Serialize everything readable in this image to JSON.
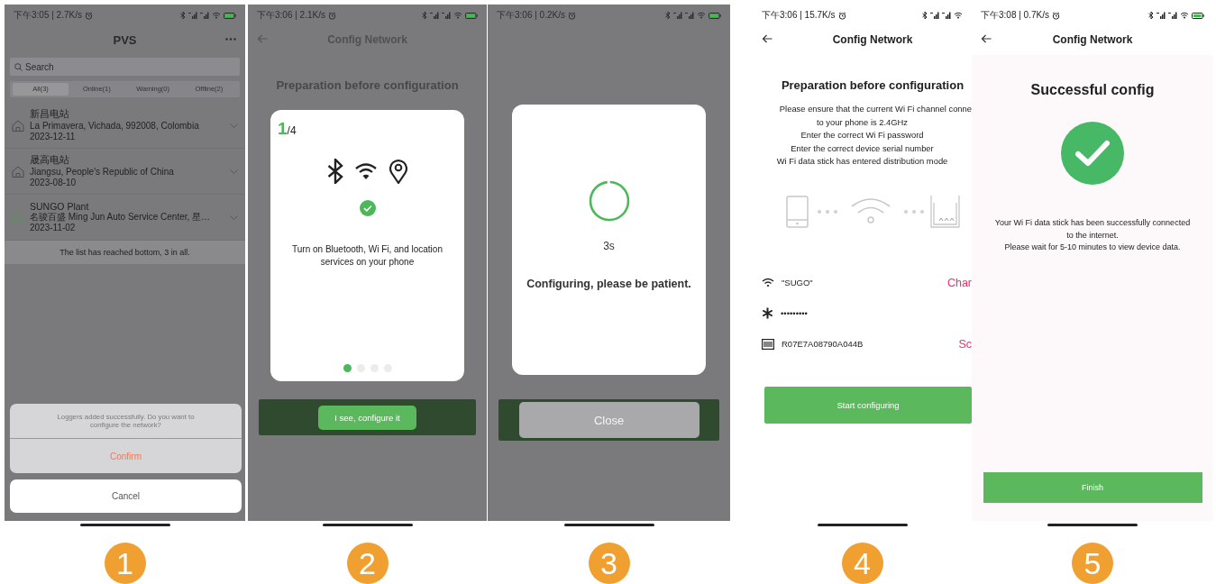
{
  "screens": [
    {
      "kind": "plant_list",
      "step": "1",
      "status_bar": {
        "time": "下午3:05 | 2.7K/s"
      },
      "title": "PVS",
      "search": {
        "placeholder": "Search"
      },
      "tabs": [
        {
          "label": "All(3)",
          "selected": true
        },
        {
          "label": "Online(1)",
          "selected": false
        },
        {
          "label": "Warning(0)",
          "selected": false
        },
        {
          "label": "Offline(2)",
          "selected": false
        }
      ],
      "plants": [
        {
          "name": "新昌电站",
          "address": "La Primavera, Vichada, 992008, Colombia",
          "date": "2023-12-11",
          "online": false
        },
        {
          "name": "晟高电站",
          "address": "Jiangsu, People's Republic of China",
          "date": "2023-08-10",
          "online": false
        },
        {
          "name": "SUNGO Plant",
          "address": "名骏百盛 Ming Jun Auto Service Center, 星…",
          "date": "2023-11-02",
          "online": true
        }
      ],
      "footer": "The list has reached bottom, 3 in all.",
      "action_sheet": {
        "message": "Loggers added successfully. Do you want to configure the network?",
        "confirm": "Confirm",
        "cancel": "Cancel"
      }
    },
    {
      "kind": "guide_dialog",
      "step": "2",
      "status_bar": {
        "time": "下午3:06 | 2.1K/s"
      },
      "title": "Config Network",
      "heading": "Preparation before configuration",
      "dialog": {
        "page": "1",
        "total": "/4",
        "text": "Turn on Bluetooth, Wi Fi, and location services on your phone",
        "pages": [
          {
            "selected": true
          },
          {
            "selected": false
          },
          {
            "selected": false
          },
          {
            "selected": false
          }
        ],
        "button": "I see, configure it"
      }
    },
    {
      "kind": "progress_dialog",
      "step": "3",
      "status_bar": {
        "time": "下午3:06 | 0.2K/s"
      },
      "dialog": {
        "countdown": "3s",
        "message": "Configuring, please be patient.",
        "button": "Close"
      }
    },
    {
      "kind": "config_form",
      "step": "4",
      "status_bar": {
        "time": "下午3:06 | 15.7K/s"
      },
      "title": "Config Network",
      "heading": "Preparation before configuration",
      "instructions": [
        "Please ensure that the current Wi Fi channel conne",
        "to your phone is 2.4GHz",
        "Enter the correct Wi Fi password",
        "Enter the correct device serial number",
        "Wi Fi data stick has entered distribution mode"
      ],
      "fields": [
        {
          "kind": "wifi",
          "value": "\"SUGO\"",
          "action": "Char"
        },
        {
          "kind": "password",
          "value": "•••••••••"
        },
        {
          "kind": "serial",
          "value": "R07E7A08790A044B",
          "action": "Sc"
        }
      ],
      "button": "Start configuring"
    },
    {
      "kind": "success",
      "step": "5",
      "status_bar": {
        "time": "下午3:08 | 0.7K/s"
      },
      "title": "Config Network",
      "heading": "Successful config",
      "messages": [
        "Your Wi Fi data stick has been successfully connected to the internet.",
        "Please wait for 5-10 minutes to view device data."
      ],
      "button": "Finish"
    }
  ]
}
